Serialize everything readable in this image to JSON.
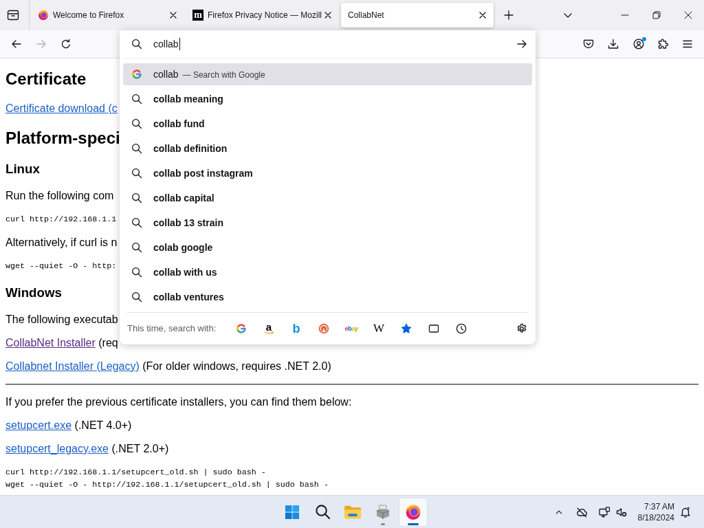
{
  "tabs": [
    {
      "title": "Welcome to Firefox",
      "favicon": {
        "kind": "firefox"
      },
      "selected": false
    },
    {
      "title": "Firefox Privacy Notice — Mozill",
      "favicon": {
        "kind": "letter",
        "text": "m"
      },
      "selected": false
    },
    {
      "title": "CollabNet",
      "selected": true
    }
  ],
  "toolbar": {
    "nav": [
      {
        "kind": "back",
        "disabled": false
      },
      {
        "kind": "forward",
        "disabled": true
      },
      {
        "kind": "reload",
        "disabled": false
      }
    ],
    "account_notification": true
  },
  "urlbar": {
    "value": "collab",
    "results": [
      {
        "kind": "engine",
        "text": "collab",
        "action": "— Search with Google",
        "selected": true
      },
      {
        "kind": "suggestion",
        "text": "collab meaning",
        "selected": false
      },
      {
        "kind": "suggestion",
        "text": "collab fund",
        "selected": false
      },
      {
        "kind": "suggestion",
        "text": "collab definition",
        "selected": false
      },
      {
        "kind": "suggestion",
        "text": "collab post instagram",
        "selected": false
      },
      {
        "kind": "suggestion",
        "text": "collab capital",
        "selected": false
      },
      {
        "kind": "suggestion",
        "text": "collab 13 strain",
        "selected": false
      },
      {
        "kind": "suggestion",
        "text": "colab google",
        "selected": false
      },
      {
        "kind": "suggestion",
        "text": "collab with us",
        "selected": false
      },
      {
        "kind": "suggestion",
        "text": "collab ventures",
        "selected": false
      }
    ],
    "footer_label": "This time, search with:",
    "engines": [
      {
        "kind": "google"
      },
      {
        "kind": "amazon",
        "text": "a"
      },
      {
        "kind": "bing",
        "text": "b"
      },
      {
        "kind": "duckduckgo"
      },
      {
        "kind": "ebay",
        "text": "ebay"
      },
      {
        "kind": "wikipedia",
        "text": "W"
      },
      {
        "kind": "bookmarks"
      },
      {
        "kind": "tabs"
      },
      {
        "kind": "history"
      }
    ]
  },
  "page": {
    "blocks": [
      {
        "kind": "h2",
        "text": "Certificate"
      },
      {
        "kind": "link_p",
        "link": "Certificate download (c",
        "visited": false
      },
      {
        "kind": "h2",
        "text": "Platform-speci"
      },
      {
        "kind": "h3",
        "text": "Linux"
      },
      {
        "kind": "p",
        "text": "Run the following com"
      },
      {
        "kind": "code",
        "lines": [
          "curl http://192.168.1.1"
        ]
      },
      {
        "kind": "p",
        "text": "Alternatively, if curl is n"
      },
      {
        "kind": "code",
        "lines": [
          "wget --quiet -O - http:"
        ]
      },
      {
        "kind": "h3",
        "text": "Windows"
      },
      {
        "kind": "p",
        "text": "The following executab"
      },
      {
        "kind": "link_p",
        "link": "CollabNet Installer",
        "visited": true,
        "note": "(req"
      },
      {
        "kind": "link_p",
        "link": "Collabnet Installer (Legacy)",
        "visited": false,
        "note": "(For older windows, requires .NET 2.0)"
      },
      {
        "kind": "rule"
      },
      {
        "kind": "p",
        "text": "If you prefer the previous certificate installers, you can find them below:"
      },
      {
        "kind": "link_p",
        "link": "setupcert.exe",
        "visited": false,
        "note": "(.NET 4.0+)"
      },
      {
        "kind": "link_p",
        "link": "setupcert_legacy.exe",
        "visited": false,
        "note": "(.NET 2.0+)"
      },
      {
        "kind": "code",
        "lines": [
          "curl http://192.168.1.1/setupcert_old.sh | sudo bash -",
          "wget --quiet -O - http://192.168.1.1/setupcert_old.sh | sudo bash -"
        ]
      }
    ]
  },
  "taskbar": {
    "apps": [
      {
        "kind": "explorer",
        "running": false,
        "selected": false
      },
      {
        "kind": "printer",
        "running": true,
        "selected": false
      },
      {
        "kind": "firefox",
        "running": true,
        "selected": true
      }
    ],
    "time": "7:37 AM",
    "date": "8/18/2024"
  }
}
